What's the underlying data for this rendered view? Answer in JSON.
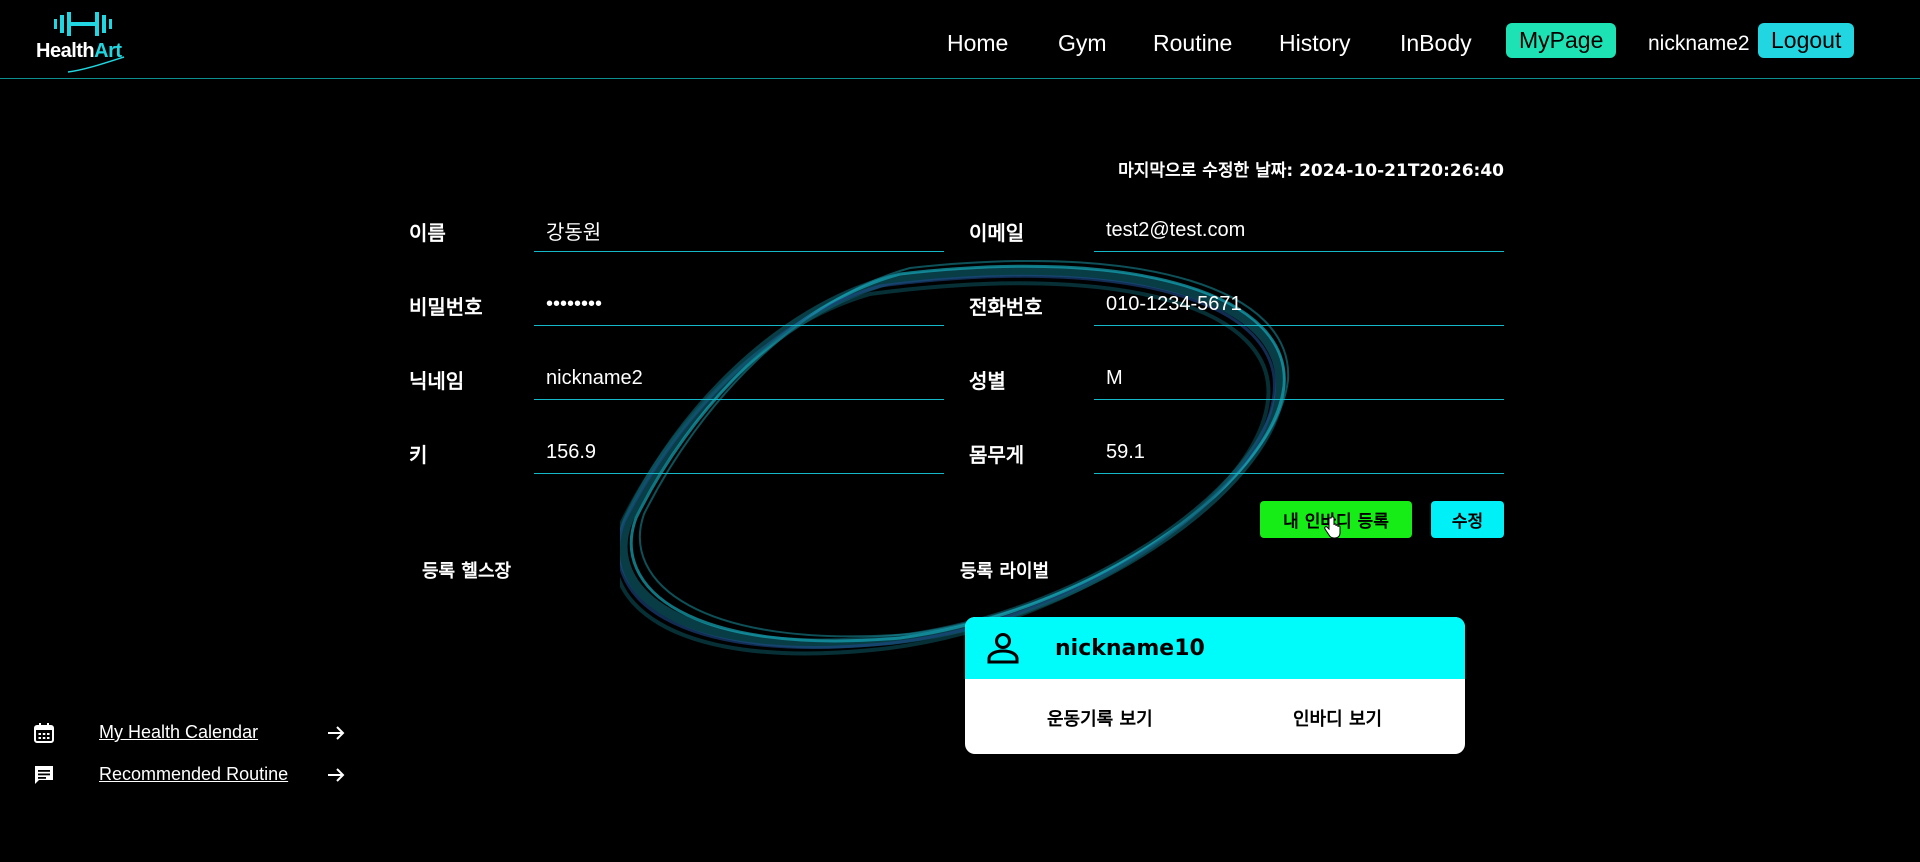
{
  "header": {
    "logo_text_1": "Health",
    "logo_text_2": "Art",
    "nav": [
      "Home",
      "Gym",
      "Routine",
      "History",
      "InBody",
      "MyPage"
    ],
    "active_nav": "MyPage",
    "nickname": "nickname2",
    "logout_label": "Logout"
  },
  "profile": {
    "last_modified": "마지막으로 수정한 날짜: 2024-10-21T20:26:40",
    "name_label": "이름",
    "name_value": "강동원",
    "email_label": "이메일",
    "email_value": "test2@test.com",
    "password_label": "비밀번호",
    "password_value": "••••••••",
    "phone_label": "전화번호",
    "phone_value": "010-1234-5671",
    "nickname_label": "닉네임",
    "nickname_value": "nickname2",
    "gender_label": "성별",
    "gender_value": "M",
    "height_label": "키",
    "height_value": "156.9",
    "weight_label": "몸무게",
    "weight_value": "59.1",
    "inbody_button": "내 인바디 등록",
    "edit_button": "수정"
  },
  "sections": {
    "gym_title": "등록 헬스장",
    "rival_title": "등록 라이벌"
  },
  "rival": {
    "name": "nickname10",
    "view_records": "운동기록 보기",
    "view_inbody": "인바디 보기"
  },
  "sidebar": {
    "calendar_link": "My Health Calendar",
    "routine_link": "Recommended Routine"
  },
  "colors": {
    "accent": "#21d6e0",
    "active_nav": "#1de3b4",
    "inbody_button": "#16ec16",
    "rival_header": "#00fbfb"
  }
}
